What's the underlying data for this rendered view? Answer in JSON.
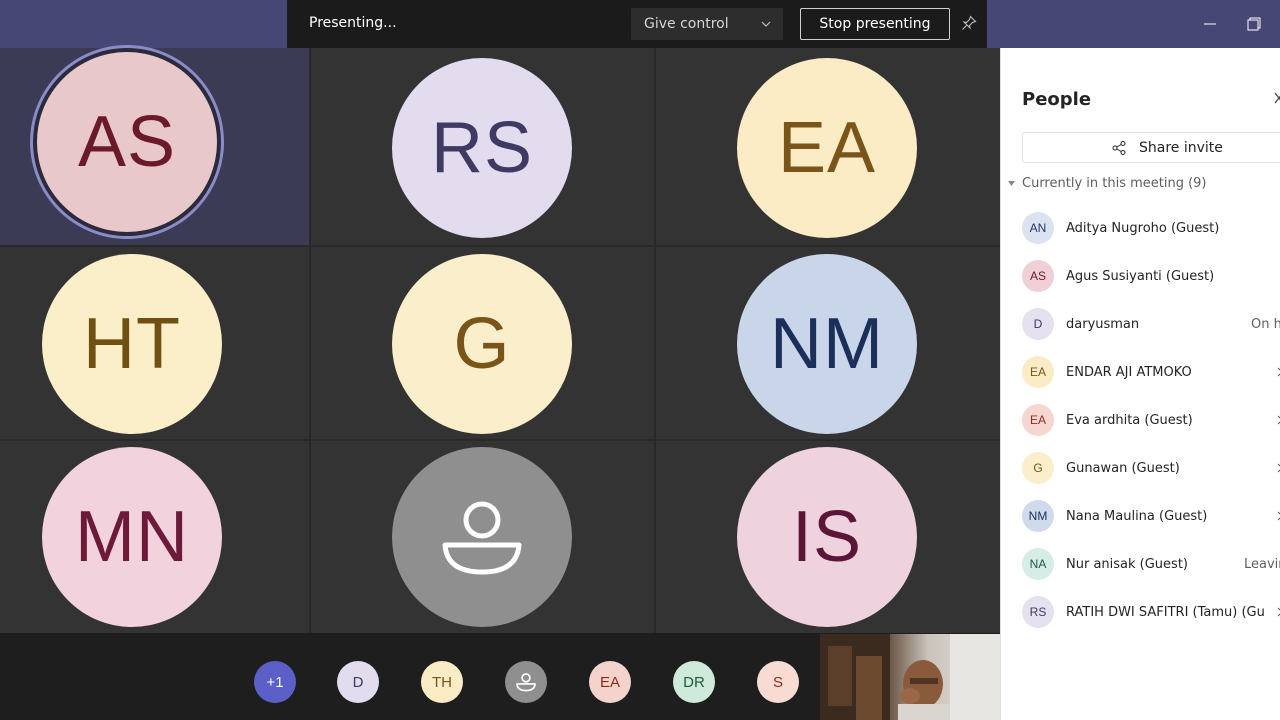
{
  "presenting_bar": {
    "status": "Presenting...",
    "give_control_label": "Give control",
    "stop_presenting_label": "Stop presenting"
  },
  "gallery": [
    {
      "initials": "AS",
      "bg": "#e9c8cc",
      "fg": "#6b1a2a",
      "active": true
    },
    {
      "initials": "RS",
      "bg": "#e2dcee",
      "fg": "#3e3a63",
      "active": false
    },
    {
      "initials": "EA",
      "bg": "#fbecc6",
      "fg": "#7a5418",
      "active": false
    },
    {
      "initials": "HT",
      "bg": "#fbefc9",
      "fg": "#6f4f12",
      "active": false
    },
    {
      "initials": "G",
      "bg": "#fbeecb",
      "fg": "#7a5418",
      "active": false
    },
    {
      "initials": "NM",
      "bg": "#c9d6ea",
      "fg": "#1c2e5a",
      "active": false
    },
    {
      "initials": "MN",
      "bg": "#f2d2dc",
      "fg": "#6d1a3a",
      "active": false
    },
    {
      "initials": "",
      "bg": "#8f8f8f",
      "fg": "#ffffff",
      "active": false,
      "icon": "person-icon"
    },
    {
      "initials": "IS",
      "bg": "#eed2de",
      "fg": "#5c1537",
      "active": false
    }
  ],
  "strip": [
    {
      "initials": "+1",
      "bg": "#5b5fc7",
      "fg": "#ffffff"
    },
    {
      "initials": "D",
      "bg": "#e2dcee",
      "fg": "#3e3a63"
    },
    {
      "initials": "TH",
      "bg": "#fbecc6",
      "fg": "#7a5418"
    },
    {
      "initials": "",
      "bg": "#8f8f8f",
      "fg": "#ffffff",
      "icon": "person-icon"
    },
    {
      "initials": "EA",
      "bg": "#f4d3cd",
      "fg": "#8a2c1c"
    },
    {
      "initials": "DR",
      "bg": "#cfeadb",
      "fg": "#1d5c3a"
    },
    {
      "initials": "S",
      "bg": "#f8dcd2",
      "fg": "#8a2c1c"
    }
  ],
  "people_panel": {
    "title": "People",
    "share_invite": "Share invite",
    "section": "Currently in this meeting (9)",
    "participants": [
      {
        "initials": "AN",
        "name": "Aditya Nugroho (Guest)",
        "status": "",
        "bg": "#dbe2f0",
        "fg": "#27366b",
        "chevron": false
      },
      {
        "initials": "AS",
        "name": "Agus Susiyanti (Guest)",
        "status": "",
        "bg": "#efd0d6",
        "fg": "#6b1a2a",
        "chevron": false
      },
      {
        "initials": "D",
        "name": "daryusman",
        "status": "On h",
        "bg": "#e6e1f1",
        "fg": "#3e3a63",
        "chevron": false
      },
      {
        "initials": "EA",
        "name": "ENDAR AJI ATMOKO",
        "status": "",
        "bg": "#fbecc6",
        "fg": "#7a5418",
        "chevron": true
      },
      {
        "initials": "EA",
        "name": "Eva ardhita (Guest)",
        "status": "",
        "bg": "#f6d6d0",
        "fg": "#8a2c1c",
        "chevron": true
      },
      {
        "initials": "G",
        "name": "Gunawan (Guest)",
        "status": "",
        "bg": "#fbefcb",
        "fg": "#7a5418",
        "chevron": true
      },
      {
        "initials": "NM",
        "name": "Nana Maulina (Guest)",
        "status": "",
        "bg": "#cfdaec",
        "fg": "#1c2e5a",
        "chevron": true
      },
      {
        "initials": "NA",
        "name": "Nur anisak (Guest)",
        "status": "Leavin",
        "bg": "#d6ece6",
        "fg": "#1d5c4a",
        "chevron": false
      },
      {
        "initials": "RS",
        "name": "RATIH DWI SAFITRI (Tamu) (Gu",
        "status": "",
        "bg": "#e6e1f1",
        "fg": "#3e3a63",
        "chevron": true
      }
    ]
  }
}
